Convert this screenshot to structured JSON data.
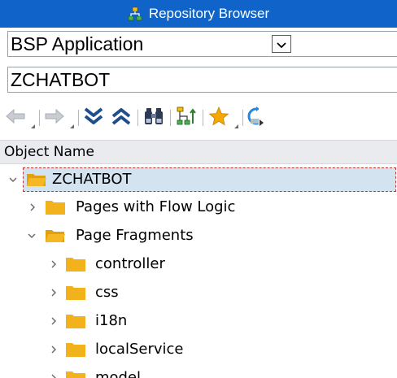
{
  "window": {
    "title": "Repository Browser",
    "title_icon": "hierarchy-icon"
  },
  "object_type": {
    "value": "BSP Application",
    "dropdown_icon": "chevron-down-icon"
  },
  "object_name": {
    "value": "ZCHATBOT"
  },
  "toolbar": {
    "buttons": [
      {
        "name": "back",
        "icon": "arrow-left-icon"
      },
      {
        "name": "forward",
        "icon": "arrow-right-icon"
      },
      {
        "name": "expand-all",
        "icon": "double-chevron-down-icon"
      },
      {
        "name": "collapse-all",
        "icon": "double-chevron-up-icon"
      },
      {
        "name": "find",
        "icon": "binoculars-icon"
      },
      {
        "name": "hierarchy",
        "icon": "hierarchy-sort-icon"
      },
      {
        "name": "favorites",
        "icon": "star-icon"
      },
      {
        "name": "refresh",
        "icon": "refresh-icon"
      }
    ]
  },
  "column_header": "Object Name",
  "tree": [
    {
      "label": "ZCHATBOT",
      "level": 0,
      "expanded": true,
      "selected": true
    },
    {
      "label": "Pages with Flow Logic",
      "level": 1,
      "expanded": false
    },
    {
      "label": "Page Fragments",
      "level": 1,
      "expanded": true
    },
    {
      "label": "controller",
      "level": 2,
      "expanded": false
    },
    {
      "label": "css",
      "level": 2,
      "expanded": false
    },
    {
      "label": "i18n",
      "level": 2,
      "expanded": false
    },
    {
      "label": "localService",
      "level": 2,
      "expanded": false
    },
    {
      "label": "model",
      "level": 2,
      "expanded": false
    }
  ],
  "colors": {
    "titlebar": "#0f63c9",
    "folder": "#f2b21c",
    "selection": "#d3e3f0",
    "focus": "#c0392b",
    "icon_blue": "#1f4e8c"
  }
}
